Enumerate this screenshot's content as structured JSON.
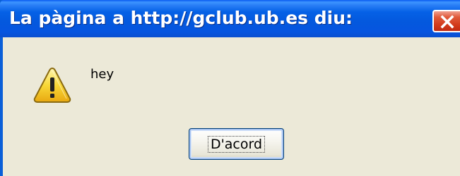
{
  "window": {
    "title": "La pàgina a http://gclub.ub.es diu:",
    "close_icon": "close-icon"
  },
  "dialog": {
    "icon": "warning-icon",
    "message": "hey",
    "ok_label": "D'acord"
  },
  "colors": {
    "titlebar": "#0458dd",
    "client_background": "#ece9d8",
    "close_button": "#d23a1a",
    "warning_yellow": "#f5c825"
  }
}
